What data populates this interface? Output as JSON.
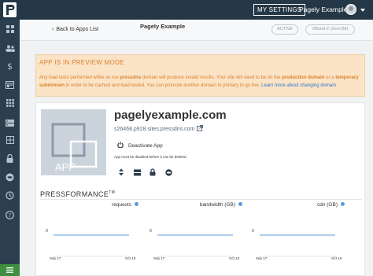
{
  "topbar": {
    "settings_label": "MY SETTINGS",
    "account_name": "Pagely Example"
  },
  "sidebar": {
    "items": [
      {
        "icon": "dashboard-icon"
      },
      {
        "icon": "users-icon"
      },
      {
        "icon": "billing-icon"
      },
      {
        "icon": "sites-icon"
      },
      {
        "icon": "apps-icon"
      },
      {
        "icon": "servers-icon"
      },
      {
        "icon": "dns-icon"
      },
      {
        "icon": "security-icon"
      },
      {
        "icon": "cdn-icon"
      },
      {
        "icon": "backup-icon"
      },
      {
        "icon": "help-icon"
      }
    ],
    "bottom_icon": "menu-toggle-icon"
  },
  "header": {
    "back_label": "Back to Apps List",
    "title": "Pagely Example",
    "status_pill": "ACTIVE",
    "server_pill": "VBurst-2 (Zero Bit)"
  },
  "banner": {
    "title": "APP IS IN PREVIEW MODE",
    "text_1": "Any load tests performed while on our ",
    "bold_1": "pressdns",
    "text_2": " domain will produce invalid results. Your site will need to be on the ",
    "bold_2": "production domain",
    "text_3": " or a ",
    "bold_3": "temporary subdomain",
    "text_4": " in order to be cached and load-tested. You can promote another domain to primary to go live. ",
    "link": "Learn more about changing domain",
    "color": "#d9822b"
  },
  "app": {
    "placeholder_label": "APP",
    "name": "pagelyexample.com",
    "host": "s26468.p928.sites.pressdns.com",
    "deactivate_label": "Deactivate App",
    "deactivate_note": "App must be disabled before it can be deleted"
  },
  "pressformance": {
    "title": "PRESSFORMANCE",
    "tm": "TM"
  },
  "chart_data": [
    {
      "type": "line",
      "series": [
        {
          "name": "requests",
          "values": [
            0,
            0
          ]
        }
      ],
      "x": [
        "Sep 17",
        "Oct 15"
      ],
      "ylabel_ticks": [
        "0"
      ]
    },
    {
      "type": "line",
      "series": [
        {
          "name": "bandwidth (GB)",
          "values": [
            0,
            0
          ]
        }
      ],
      "x": [
        "Sep 17",
        "Oct 15"
      ],
      "ylabel_ticks": [
        "0"
      ]
    },
    {
      "type": "line",
      "series": [
        {
          "name": "cdn (GB)",
          "values": [
            0,
            0
          ]
        }
      ],
      "x": [
        "Sep 17",
        "Oct 15"
      ],
      "ylabel_ticks": [
        "0"
      ]
    }
  ]
}
